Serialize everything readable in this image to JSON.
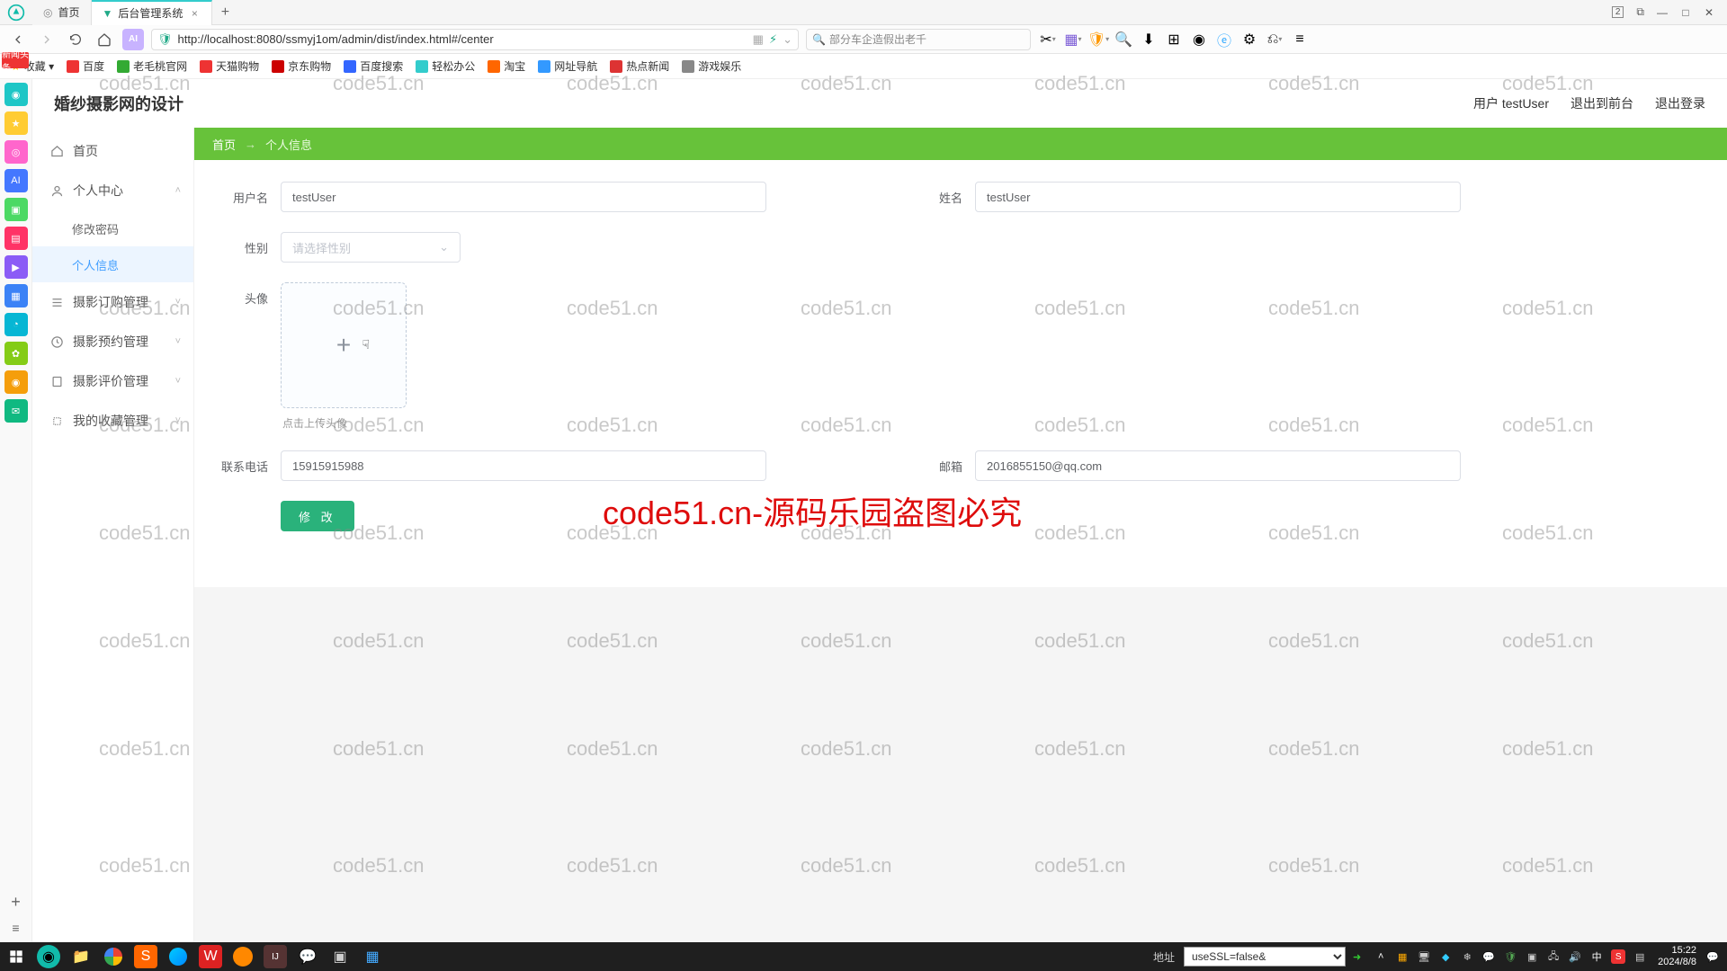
{
  "browser": {
    "tabs": [
      {
        "title": "首页",
        "active": false
      },
      {
        "title": "后台管理系统",
        "active": true
      }
    ],
    "url": "http://localhost:8080/ssmyj1om/admin/dist/index.html#/center",
    "search_placeholder": "部分车企造假出老千",
    "window_badge": "2"
  },
  "bookmarks": {
    "fav_label": "收藏 ▾",
    "items": [
      "百度",
      "老毛桃官网",
      "天猫购物",
      "京东购物",
      "百度搜索",
      "轻松办公",
      "淘宝",
      "网址导航",
      "热点新闻",
      "游戏娱乐"
    ]
  },
  "app": {
    "title": "婚纱摄影网的设计",
    "header_right": {
      "user": "用户 testUser",
      "to_front": "退出到前台",
      "logout": "退出登录"
    }
  },
  "sidebar": {
    "items": [
      {
        "icon": "home",
        "label": "首页",
        "expandable": false
      },
      {
        "icon": "user",
        "label": "个人中心",
        "expandable": true,
        "open": true,
        "children": [
          {
            "label": "修改密码",
            "active": false
          },
          {
            "label": "个人信息",
            "active": true
          }
        ]
      },
      {
        "icon": "list",
        "label": "摄影订购管理",
        "expandable": true
      },
      {
        "icon": "clock",
        "label": "摄影预约管理",
        "expandable": true
      },
      {
        "icon": "star",
        "label": "摄影评价管理",
        "expandable": true
      },
      {
        "icon": "heart",
        "label": "我的收藏管理",
        "expandable": true
      }
    ]
  },
  "breadcrumb": {
    "home": "首页",
    "sep": "→",
    "current": "个人信息"
  },
  "form": {
    "username_label": "用户名",
    "username_value": "testUser",
    "name_label": "姓名",
    "name_value": "testUser",
    "gender_label": "性别",
    "gender_placeholder": "请选择性别",
    "avatar_label": "头像",
    "avatar_hint": "点击上传头像",
    "phone_label": "联系电话",
    "phone_value": "15915915988",
    "email_label": "邮箱",
    "email_value": "2016855150@qq.com",
    "submit": "修 改"
  },
  "watermark": {
    "text": "code51.cn",
    "big": "code51.cn-源码乐园盗图必究"
  },
  "red_badge": "新闻头条",
  "taskbar": {
    "addr_label": "地址",
    "select_value": "useSSL=false&",
    "time": "15:22",
    "date": "2024/8/8"
  }
}
